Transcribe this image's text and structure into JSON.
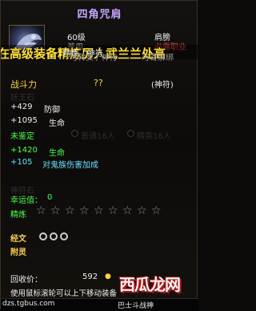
{
  "item": {
    "name": "四角咒肩",
    "level": "60级",
    "slot": "肩膀",
    "row3_left": "普用",
    "row3_right": "必需职业",
    "row4_left": "可转卖 / 神符",
    "row4_right": "可寄解绑"
  },
  "banner": {
    "text": "在高级装备精炼厉人武兰兰处高",
    "overlay": "精炼 / 神符"
  },
  "power": {
    "label": "战斗力",
    "value": "??",
    "tag": "(神符)"
  },
  "stats": [
    {
      "value": "+429",
      "label": "防御"
    },
    {
      "value": "+1095",
      "label": "生命"
    }
  ],
  "unidentified": "未鉴定",
  "bonus": [
    {
      "value": "+1420",
      "label": "生命"
    },
    {
      "value": "+105",
      "label": "对鬼族伤害加成"
    }
  ],
  "ghost": {
    "header": "妖王石",
    "opt1": "普通16人",
    "opt2": "精英16人",
    "rune": "神符石"
  },
  "luck": {
    "label": "幸运值：",
    "value": "0"
  },
  "refine": {
    "label": "精炼",
    "stars": 9
  },
  "meridian": {
    "label": "经文",
    "rings": 3
  },
  "attach": {
    "label": "附灵"
  },
  "recycle": {
    "label": "回收价：",
    "value": "592"
  },
  "hint": "使用鼠标滚轮可以上下移动装备",
  "watermark": {
    "left": "dzs.tgbus.com",
    "right": "巴士斗战神",
    "logo": "西瓜龙网"
  },
  "colors": {
    "title": "#c7a7ff",
    "gold": "#ffd24a",
    "green": "#4cff4c",
    "cyan": "#66e0ff",
    "red": "#e84a3a"
  }
}
